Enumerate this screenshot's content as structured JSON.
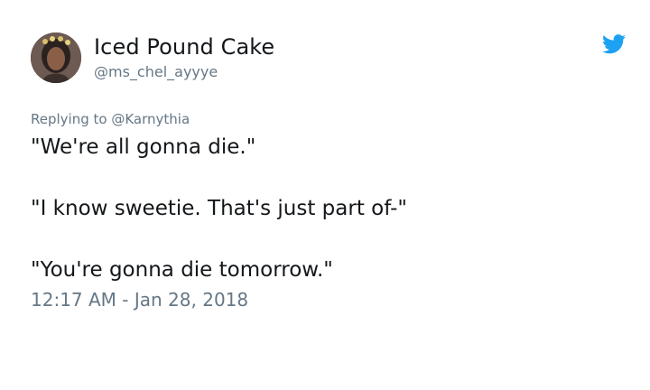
{
  "tweet": {
    "user": {
      "display_name": "Iced Pound Cake",
      "handle": "@ms_chel_ayyye",
      "avatar_icon": "user-avatar-photo"
    },
    "brand_icon": "twitter-bird-icon",
    "brand_color": "#1da1f2",
    "replying_prefix": "Replying to",
    "replying_to": "@Karnythia",
    "lines": [
      "\"We're all gonna die.\"",
      "\"I know sweetie. That's just part of-\"",
      "\"You're gonna die tomorrow.\""
    ],
    "timestamp": "12:17 AM - Jan 28, 2018"
  }
}
